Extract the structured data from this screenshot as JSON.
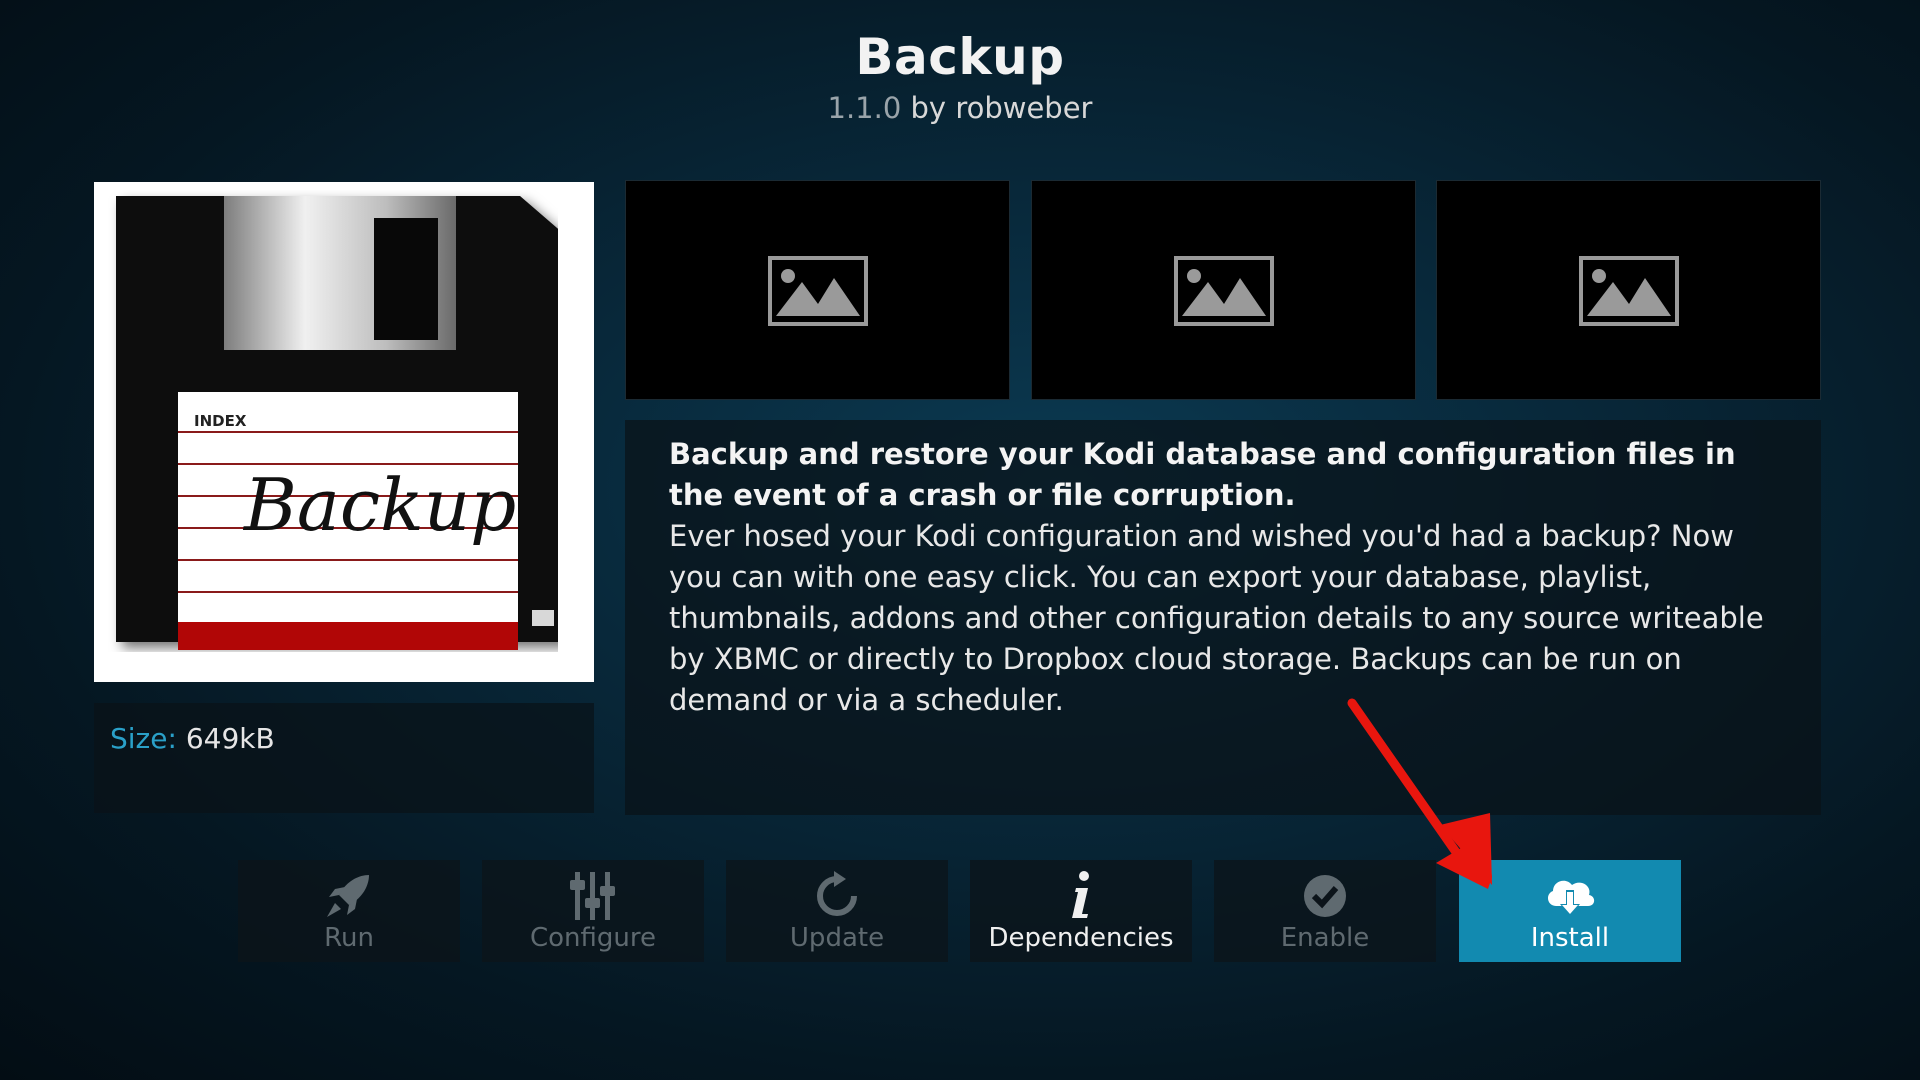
{
  "header": {
    "title": "Backup",
    "version": "1.1.0",
    "author_prefix": "by",
    "author": "robweber"
  },
  "addon_icon": {
    "index_label": "INDEX",
    "script_text": "Backup"
  },
  "info": {
    "size_label": "Size:",
    "size_value": "649kB"
  },
  "screenshots": [
    {
      "icon": "image-placeholder-icon"
    },
    {
      "icon": "image-placeholder-icon"
    },
    {
      "icon": "image-placeholder-icon"
    }
  ],
  "description": {
    "summary": "Backup and restore your Kodi database and configuration files in the event of a crash or file corruption.",
    "body": "Ever hosed your Kodi configuration and wished you'd had a backup? Now you can with one easy click. You can export your database, playlist, thumbnails, addons and other configuration details to any source writeable by XBMC or directly to Dropbox cloud storage. Backups can be run on demand or via a scheduler."
  },
  "buttons": [
    {
      "label": "Run",
      "icon": "rocket-icon",
      "state": "disabled"
    },
    {
      "label": "Configure",
      "icon": "sliders-icon",
      "state": "disabled"
    },
    {
      "label": "Update",
      "icon": "refresh-icon",
      "state": "disabled"
    },
    {
      "label": "Dependencies",
      "icon": "info-icon",
      "state": "enabled"
    },
    {
      "label": "Enable",
      "icon": "checkmark-icon",
      "state": "disabled"
    },
    {
      "label": "Install",
      "icon": "cloud-download-icon",
      "state": "focused"
    }
  ],
  "colors": {
    "accent": "#128ab0",
    "label_blue": "#2aa0c8",
    "annotation_arrow": "#e8160e"
  }
}
